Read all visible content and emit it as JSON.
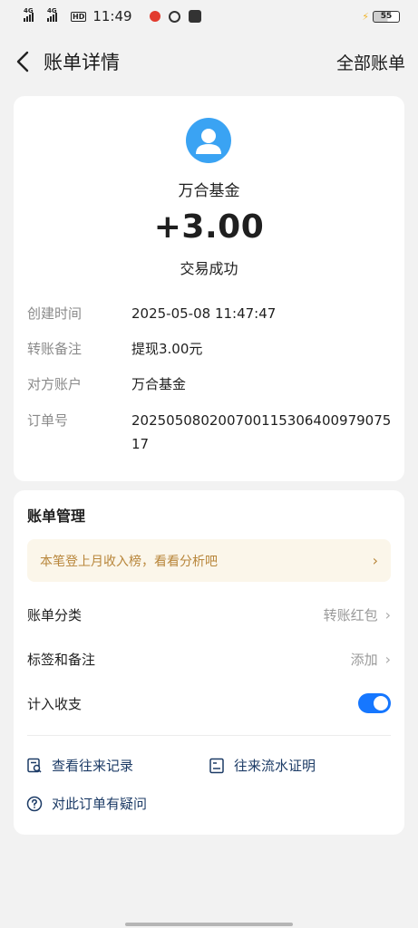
{
  "status_bar": {
    "network1": "4G",
    "network2": "4G",
    "hd": "HD",
    "time": "11:49",
    "battery": "55",
    "icons": [
      "signal-icon",
      "signal-icon",
      "hd-icon",
      "app-red-icon",
      "app-link-icon",
      "taobao-icon",
      "charging-bolt-icon",
      "battery-icon"
    ]
  },
  "nav": {
    "title": "账单详情",
    "right_label": "全部账单"
  },
  "summary": {
    "payee": "万合基金",
    "amount": "+3.00",
    "status": "交易成功"
  },
  "details": [
    {
      "label": "创建时间",
      "value": "2025-05-08 11:47:47"
    },
    {
      "label": "转账备注",
      "value": "提现3.00元"
    },
    {
      "label": "对方账户",
      "value": "万合基金"
    },
    {
      "label": "订单号",
      "value": "20250508020070011530640097907517"
    }
  ],
  "management": {
    "title": "账单管理",
    "tip": "本笔登上月收入榜，看看分析吧",
    "category_label": "账单分类",
    "category_value": "转账红包",
    "tags_label": "标签和备注",
    "tags_value": "添加",
    "include_label": "计入收支",
    "include_on": true,
    "link_records": "查看往来记录",
    "link_proof": "往来流水证明",
    "link_question": "对此订单有疑问"
  },
  "colors": {
    "accent": "#1677ff",
    "avatar_bg": "#3aa3f3",
    "tip_bg": "#fbf6ea",
    "tip_text": "#b8863b",
    "link_text": "#1c3b66"
  }
}
